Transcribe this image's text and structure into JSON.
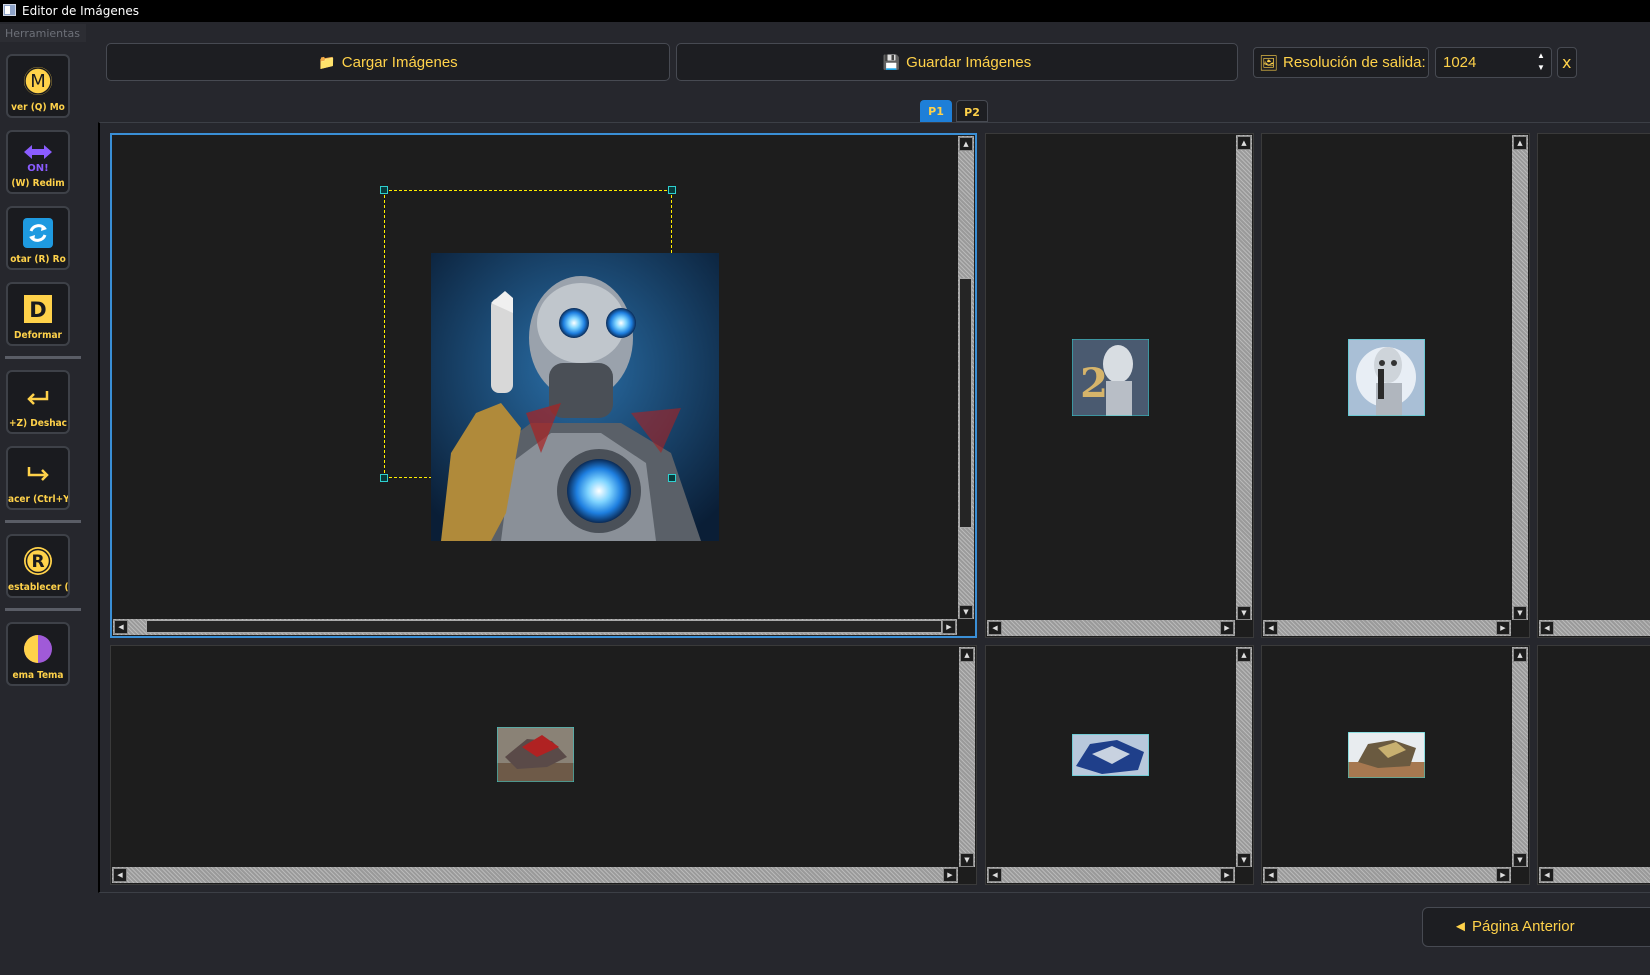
{
  "window": {
    "title": "Editor de Imágenes"
  },
  "menu": {
    "label": "Herramientas"
  },
  "tools": [
    {
      "label": "ver (Q)   Mo",
      "icon": "M"
    },
    {
      "label": "(W)   Redim",
      "icon": "ON!"
    },
    {
      "label": "otar (R)   Ro",
      "icon": "rotate"
    },
    {
      "label": "  Deformar",
      "icon": "D"
    },
    {
      "label": "+Z)   Deshac",
      "icon": "undo"
    },
    {
      "label": "acer (Ctrl+Y",
      "icon": "redo"
    },
    {
      "label": "establecer (T",
      "icon": "R"
    },
    {
      "label": "ema   Tema",
      "icon": "theme"
    }
  ],
  "toolbar": {
    "load_label": "Cargar Imágenes",
    "save_label": "Guardar Imágenes",
    "resolution_label": "Resolución de salida:",
    "resolution_value": "1024",
    "extra_button": "x"
  },
  "tabs": [
    {
      "label": "P1",
      "active": true
    },
    {
      "label": "P2",
      "active": false
    }
  ],
  "pagination": {
    "prev_label": "◄ Página Anterior"
  },
  "colors": {
    "accent": "#ffd24a",
    "active_tab": "#1e7fd8",
    "selection": "#3a8fd6",
    "handle": "#2fd0d0"
  },
  "panels": [
    {
      "id": "p1",
      "image": "robot showing number 1",
      "active": true
    },
    {
      "id": "p2",
      "image": "robot with number 2"
    },
    {
      "id": "p3",
      "image": "robot with number 1"
    },
    {
      "id": "p4",
      "image": "red mech robot"
    },
    {
      "id": "p5",
      "image": "blue mech robot"
    },
    {
      "id": "p6",
      "image": "desert mech robot"
    }
  ]
}
